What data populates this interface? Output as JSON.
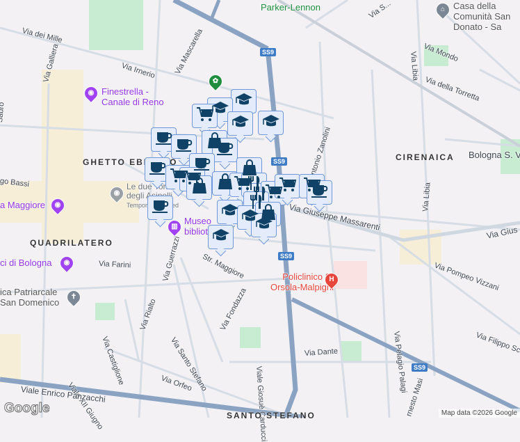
{
  "streets": {
    "via_dei_mille": "Via dei Mille",
    "via_irnerio": "Via Irnerio",
    "via_mascarella": "Via Mascarella",
    "via_galliera": "Via Galliera",
    "via_saffi": "Via S...",
    "via_mondo": "Via Mondo",
    "via_libia": "Via Libia",
    "via_libia2": "Via Libia",
    "via_della_torretta": "Via della Torretta",
    "via_zanolini": "Antonio Zanolini",
    "via_massarenti": "Via Giuseppe Massarenti",
    "via_gius": "Via Gius",
    "via_pompeo": "Via Pompeo Vizzani",
    "via_pelagio": "Via Pelagio Palagi",
    "via_filippo": "Via Filippo Sc",
    "via_dante": "Via Dante",
    "viale_carducci": "Viale Giosuè Carducci",
    "via_farini": "Via Farini",
    "str_maggiore": "Str. Maggiore",
    "via_guerrazzi": "Via Guerrazzi",
    "via_castiglione": "Via Castiglione",
    "via_rialto": "Via Rialto",
    "via_santo_stefano": "Via Santo Stefano",
    "via_fondazza": "Via Fondazza",
    "viale_xii": "Viale XII Giugno",
    "via_orfeo": "Via Orfeo",
    "viale_panzacchi": "Viale Enrico Panzacchi",
    "ugo_bassi": "go Bassi",
    "via_sauro": "Sauro",
    "ernesto_masi": "rnesto Masi"
  },
  "districts": {
    "ghetto": "GHETTO EBRAICO",
    "quadrilatero": "QUADRILATERO",
    "cirenaica": "CIRENAICA",
    "santo_stefano": "SANTO STEFANO"
  },
  "pois": {
    "finestrella": "Finestrella - Canale di Reno",
    "parker": "Parker-Lennon",
    "casa": "Casa della Comunità San Donato - Sa",
    "bologna_sv": "Bologna S. V",
    "le_due_torri": "Le due Torri e degli Asinelli",
    "temp_closed": "Temporarily closed",
    "piazza_maggiore": "a Maggiore",
    "musei": "ci di Bologna",
    "san_domenico": "ica Patriarcale San Domenico",
    "museo": "Museo biblioteca",
    "policlinico": "Policlinico S. Orsola-Malpighi"
  },
  "road_shield": "SS9",
  "markers": [
    "graduation-cap",
    "graduation-cap",
    "shopping-cart",
    "graduation-cap",
    "graduation-cap",
    "coffee-cup",
    "coffee-cup",
    "shopping-bag",
    "coffee-cup",
    "coffee-cup",
    "shopping-cart",
    "coffee-cup",
    "shopping-bag",
    "shopping-cart",
    "shopping-bag",
    "shopping-bag",
    "shopping-cart",
    "fork-knife",
    "fork-knife",
    "shopping-cart",
    "fork-knife",
    "shopping-cart",
    "shopping-cart",
    "coffee-cup",
    "coffee-cup",
    "graduation-cap",
    "graduation-cap",
    "shopping-bag",
    "graduation-cap",
    "graduation-cap"
  ],
  "footer": {
    "logo": "Google",
    "attribution": "Map data ©2026 Google"
  },
  "colors": {
    "marker_fill": "#e4ecfb",
    "marker_border": "#6f97db",
    "icon": "#0f4266",
    "poi_purple": "#9334e6",
    "hospital": "#e8453c"
  }
}
